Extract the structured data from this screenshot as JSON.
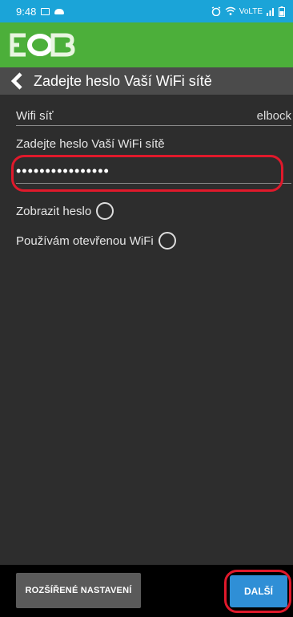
{
  "status_bar": {
    "time": "9:48",
    "right_indicators": "VoLTE",
    "icons": [
      "image-icon",
      "cloud-icon",
      "alarm-icon",
      "wifi-icon",
      "signal-icon",
      "battery-icon"
    ]
  },
  "app": {
    "logo_text": "EOB",
    "brand_color": "#4caf3a",
    "status_color": "#1ba4d8"
  },
  "header": {
    "title": "Zadejte heslo Vaší WiFi sítě",
    "back_icon": "back-chevron-icon"
  },
  "form": {
    "wifi_label": "Wifi síť",
    "wifi_value": "elbock",
    "password_label": "Zadejte heslo Vaší WiFi sítě",
    "password_value": "••••••••••••••••",
    "show_password_label": "Zobrazit heslo",
    "open_wifi_label": "Používám otevřenou WiFi"
  },
  "actions": {
    "advanced_label": "ROZŠÍŘENÉ NASTAVENÍ",
    "next_label": "DALŠÍ"
  },
  "annotations": {
    "highlight_color": "#e0192b"
  }
}
